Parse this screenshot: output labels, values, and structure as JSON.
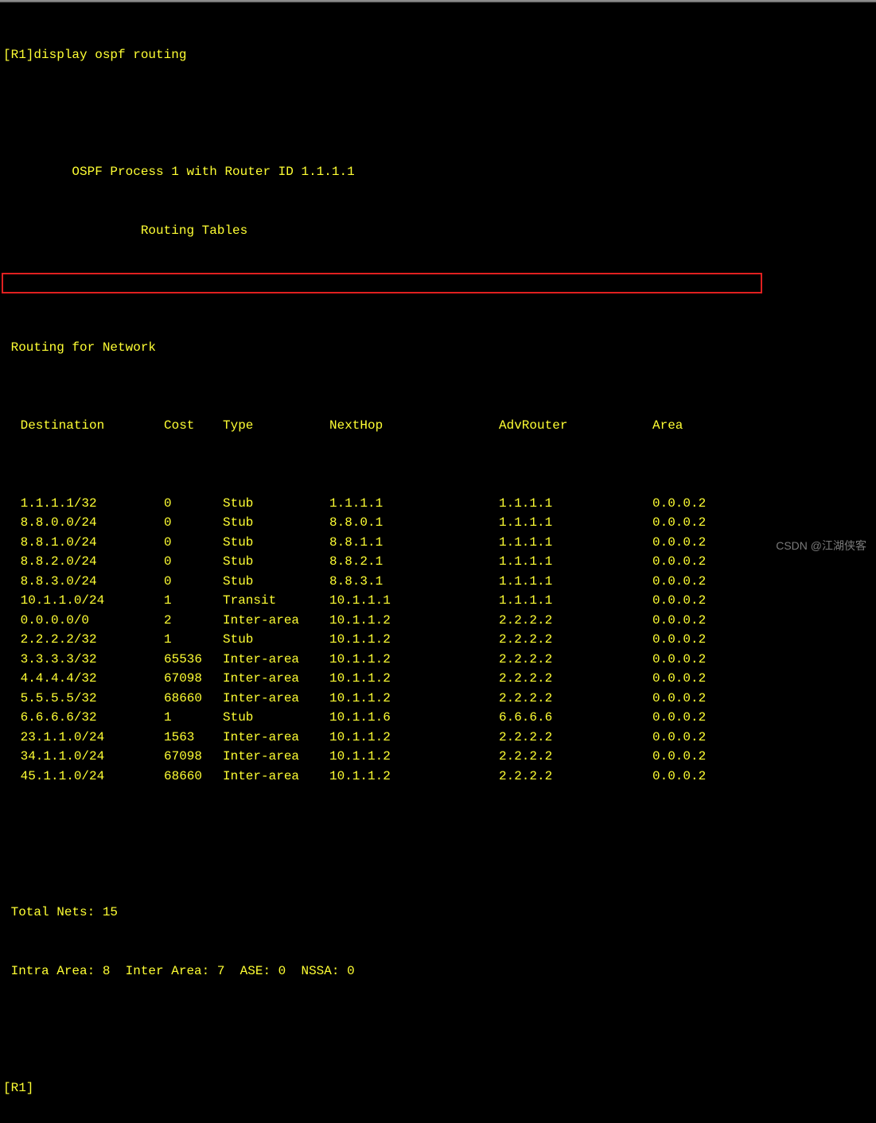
{
  "prompt_line": "[R1]display ospf routing",
  "header1": "         OSPF Process 1 with Router ID 1.1.1.1",
  "header2": "                  Routing Tables",
  "section_title": " Routing for Network",
  "columns": {
    "destination": " Destination",
    "cost": "Cost",
    "type": "Type",
    "nexthop": "NextHop",
    "advrouter": "AdvRouter",
    "area": "Area"
  },
  "rows": [
    {
      "destination": " 1.1.1.1/32",
      "cost": "0",
      "type": "Stub",
      "nexthop": "1.1.1.1",
      "advrouter": "1.1.1.1",
      "area": "0.0.0.2"
    },
    {
      "destination": " 8.8.0.0/24",
      "cost": "0",
      "type": "Stub",
      "nexthop": "8.8.0.1",
      "advrouter": "1.1.1.1",
      "area": "0.0.0.2"
    },
    {
      "destination": " 8.8.1.0/24",
      "cost": "0",
      "type": "Stub",
      "nexthop": "8.8.1.1",
      "advrouter": "1.1.1.1",
      "area": "0.0.0.2"
    },
    {
      "destination": " 8.8.2.0/24",
      "cost": "0",
      "type": "Stub",
      "nexthop": "8.8.2.1",
      "advrouter": "1.1.1.1",
      "area": "0.0.0.2"
    },
    {
      "destination": " 8.8.3.0/24",
      "cost": "0",
      "type": "Stub",
      "nexthop": "8.8.3.1",
      "advrouter": "1.1.1.1",
      "area": "0.0.0.2"
    },
    {
      "destination": " 10.1.1.0/24",
      "cost": "1",
      "type": "Transit",
      "nexthop": "10.1.1.1",
      "advrouter": "1.1.1.1",
      "area": "0.0.0.2"
    },
    {
      "destination": " 0.0.0.0/0",
      "cost": "2",
      "type": "Inter-area",
      "nexthop": "10.1.1.2",
      "advrouter": "2.2.2.2",
      "area": "0.0.0.2",
      "highlighted": true
    },
    {
      "destination": " 2.2.2.2/32",
      "cost": "1",
      "type": "Stub",
      "nexthop": "10.1.1.2",
      "advrouter": "2.2.2.2",
      "area": "0.0.0.2"
    },
    {
      "destination": " 3.3.3.3/32",
      "cost": "65536",
      "type": "Inter-area",
      "nexthop": "10.1.1.2",
      "advrouter": "2.2.2.2",
      "area": "0.0.0.2"
    },
    {
      "destination": " 4.4.4.4/32",
      "cost": "67098",
      "type": "Inter-area",
      "nexthop": "10.1.1.2",
      "advrouter": "2.2.2.2",
      "area": "0.0.0.2"
    },
    {
      "destination": " 5.5.5.5/32",
      "cost": "68660",
      "type": "Inter-area",
      "nexthop": "10.1.1.2",
      "advrouter": "2.2.2.2",
      "area": "0.0.0.2"
    },
    {
      "destination": " 6.6.6.6/32",
      "cost": "1",
      "type": "Stub",
      "nexthop": "10.1.1.6",
      "advrouter": "6.6.6.6",
      "area": "0.0.0.2"
    },
    {
      "destination": " 23.1.1.0/24",
      "cost": "1563",
      "type": "Inter-area",
      "nexthop": "10.1.1.2",
      "advrouter": "2.2.2.2",
      "area": "0.0.0.2"
    },
    {
      "destination": " 34.1.1.0/24",
      "cost": "67098",
      "type": "Inter-area",
      "nexthop": "10.1.1.2",
      "advrouter": "2.2.2.2",
      "area": "0.0.0.2"
    },
    {
      "destination": " 45.1.1.0/24",
      "cost": "68660",
      "type": "Inter-area",
      "nexthop": "10.1.1.2",
      "advrouter": "2.2.2.2",
      "area": "0.0.0.2"
    }
  ],
  "totals_line": " Total Nets: 15",
  "summary_line": " Intra Area: 8  Inter Area: 7  ASE: 0  NSSA: 0",
  "prompt_end": "[R1]",
  "watermark": "CSDN @江湖侠客"
}
